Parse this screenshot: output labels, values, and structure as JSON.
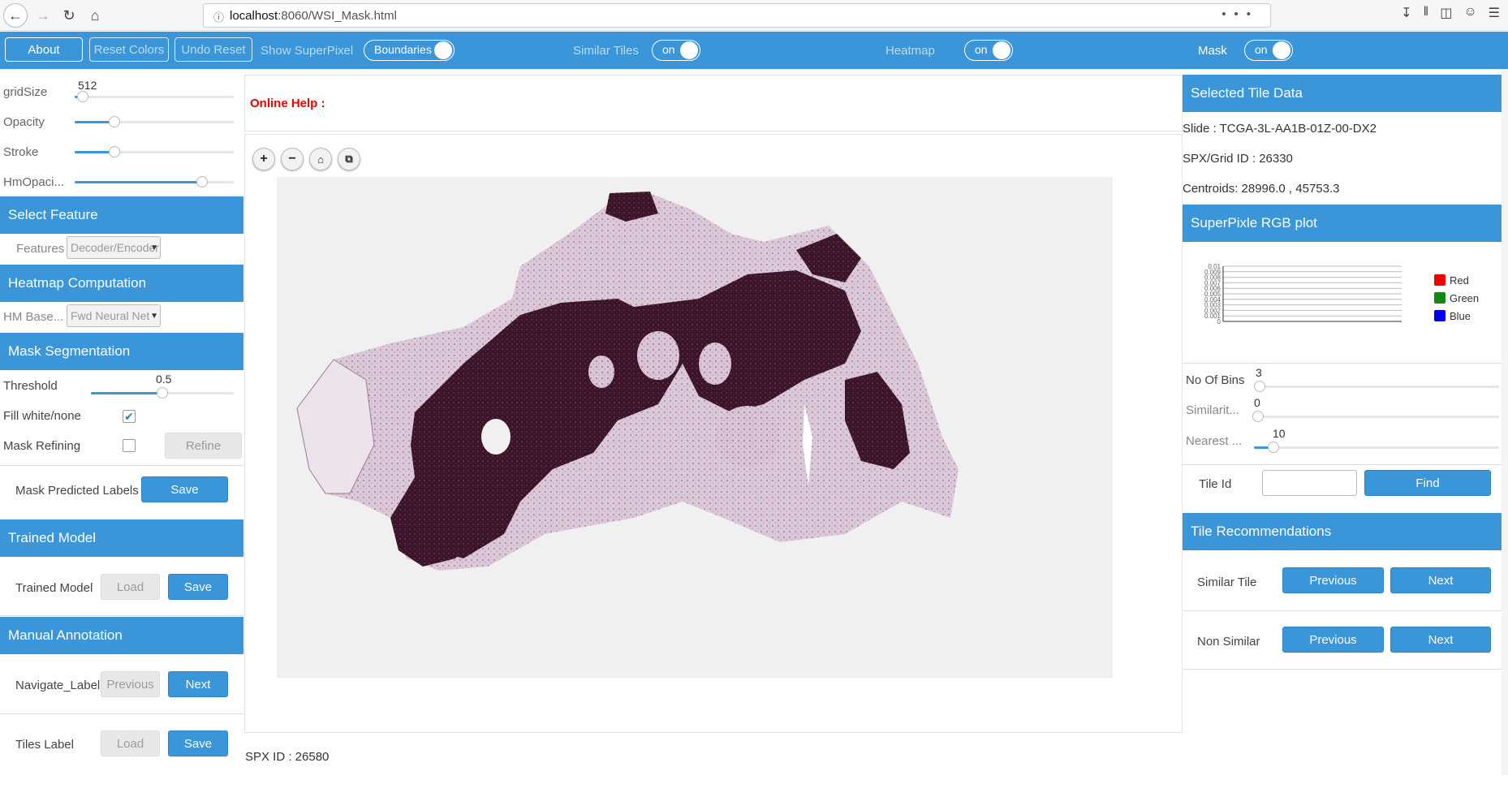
{
  "browser": {
    "url_host": "localhost",
    "url_path": ":8060/WSI_Mask.html",
    "url_dots": "•••"
  },
  "toolbar": {
    "about": "About",
    "reset_colors": "Reset Colors",
    "undo_reset": "Undo Reset",
    "show_superpixel": "Show SuperPixel",
    "boundaries": "Boundaries",
    "similar_tiles": "Similar Tiles",
    "similar_tiles_state": "on",
    "heatmap": "Heatmap",
    "heatmap_state": "on",
    "mask": "Mask",
    "mask_state": "on"
  },
  "left": {
    "sliders": {
      "gridsize_label": "gridSize",
      "gridsize_value": "512",
      "gridsize_level": 0.05,
      "opacity_label": "Opacity",
      "opacity_level": 0.25,
      "stroke_label": "Stroke",
      "stroke_level": 0.25,
      "hmopacity_label": "HmOpaci...",
      "hmopacity_level": 0.8
    },
    "select_feature": {
      "header": "Select Feature",
      "features_label": "Features",
      "features_value": "Decoder/Encoder"
    },
    "heatmap": {
      "header": "Heatmap Computation",
      "hm_label": "HM Base...",
      "hm_value": "Fwd Neural Net"
    },
    "mask": {
      "header": "Mask Segmentation",
      "threshold_label": "Threshold",
      "threshold_value": "0.5",
      "threshold_level": 0.5,
      "fill_label": "Fill white/none",
      "fill_checked": "✔",
      "refining_label": "Mask Refining",
      "refine_button": "Refine",
      "predicted_label": "Mask Predicted Labels",
      "save_button": "Save"
    },
    "trained_model": {
      "header": "Trained Model",
      "label": "Trained Model",
      "load": "Load",
      "save": "Save"
    },
    "manual": {
      "header": "Manual Annotation",
      "navigate_label": "Navigate_Label",
      "previous": "Previous",
      "next": "Next",
      "tiles_label": "Tiles Label",
      "load": "Load",
      "save": "Save"
    }
  },
  "center": {
    "online_help": "Online Help :",
    "zoom_in": "+",
    "zoom_out": "−",
    "home": "⌂",
    "fullscreen": "⧉",
    "spx_id": "SPX ID : 26580"
  },
  "right": {
    "selected_header": "Selected Tile Data",
    "slide": "Slide : TCGA-3L-AA1B-01Z-00-DX2",
    "grid_id": "SPX/Grid ID : 26330",
    "centroids": "Centroids: 28996.0 , 45753.3",
    "rgb_header": "SuperPixle RGB plot",
    "legend": [
      {
        "name": "Red",
        "color": "#ee0000"
      },
      {
        "name": "Green",
        "color": "#118811"
      },
      {
        "name": "Blue",
        "color": "#0000ee"
      }
    ],
    "y_ticks": [
      "0.01",
      "0.009",
      "0.008",
      "0.007",
      "0.006",
      "0.005",
      "0.004",
      "0.003",
      "0.002",
      "0.001",
      "0"
    ],
    "bins_label": "No Of Bins",
    "bins_value": "3",
    "bins_level": 0.0,
    "similarity_label": "Similarit...",
    "similarity_value": "0",
    "similarity_level": 0.0,
    "nearest_label": "Nearest ...",
    "nearest_value": "10",
    "nearest_level": 0.08,
    "tile_id_label": "Tile Id",
    "find": "Find",
    "recommend_header": "Tile Recommendations",
    "similar_label": "Similar Tile",
    "non_similar_label": "Non Similar",
    "previous": "Previous",
    "next": "Next"
  },
  "colors": {
    "accent": "#3a96d8",
    "tissue_dark": "#3a1428",
    "tissue_light": "#d9c5d6"
  }
}
